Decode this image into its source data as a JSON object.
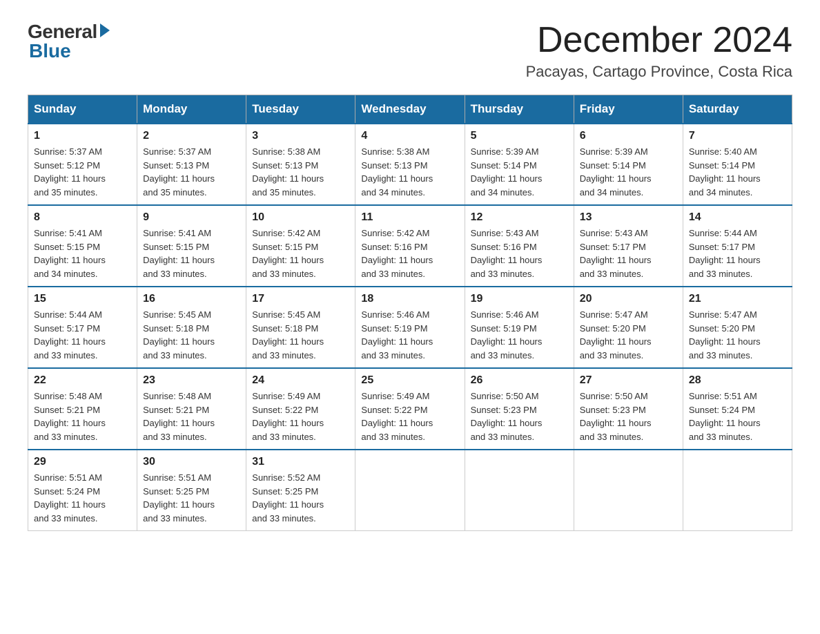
{
  "header": {
    "logo_general": "General",
    "logo_blue": "Blue",
    "main_title": "December 2024",
    "subtitle": "Pacayas, Cartago Province, Costa Rica"
  },
  "days_of_week": [
    "Sunday",
    "Monday",
    "Tuesday",
    "Wednesday",
    "Thursday",
    "Friday",
    "Saturday"
  ],
  "weeks": [
    [
      {
        "day": "1",
        "sunrise": "5:37 AM",
        "sunset": "5:12 PM",
        "daylight": "11 hours and 35 minutes."
      },
      {
        "day": "2",
        "sunrise": "5:37 AM",
        "sunset": "5:13 PM",
        "daylight": "11 hours and 35 minutes."
      },
      {
        "day": "3",
        "sunrise": "5:38 AM",
        "sunset": "5:13 PM",
        "daylight": "11 hours and 35 minutes."
      },
      {
        "day": "4",
        "sunrise": "5:38 AM",
        "sunset": "5:13 PM",
        "daylight": "11 hours and 34 minutes."
      },
      {
        "day": "5",
        "sunrise": "5:39 AM",
        "sunset": "5:14 PM",
        "daylight": "11 hours and 34 minutes."
      },
      {
        "day": "6",
        "sunrise": "5:39 AM",
        "sunset": "5:14 PM",
        "daylight": "11 hours and 34 minutes."
      },
      {
        "day": "7",
        "sunrise": "5:40 AM",
        "sunset": "5:14 PM",
        "daylight": "11 hours and 34 minutes."
      }
    ],
    [
      {
        "day": "8",
        "sunrise": "5:41 AM",
        "sunset": "5:15 PM",
        "daylight": "11 hours and 34 minutes."
      },
      {
        "day": "9",
        "sunrise": "5:41 AM",
        "sunset": "5:15 PM",
        "daylight": "11 hours and 33 minutes."
      },
      {
        "day": "10",
        "sunrise": "5:42 AM",
        "sunset": "5:15 PM",
        "daylight": "11 hours and 33 minutes."
      },
      {
        "day": "11",
        "sunrise": "5:42 AM",
        "sunset": "5:16 PM",
        "daylight": "11 hours and 33 minutes."
      },
      {
        "day": "12",
        "sunrise": "5:43 AM",
        "sunset": "5:16 PM",
        "daylight": "11 hours and 33 minutes."
      },
      {
        "day": "13",
        "sunrise": "5:43 AM",
        "sunset": "5:17 PM",
        "daylight": "11 hours and 33 minutes."
      },
      {
        "day": "14",
        "sunrise": "5:44 AM",
        "sunset": "5:17 PM",
        "daylight": "11 hours and 33 minutes."
      }
    ],
    [
      {
        "day": "15",
        "sunrise": "5:44 AM",
        "sunset": "5:17 PM",
        "daylight": "11 hours and 33 minutes."
      },
      {
        "day": "16",
        "sunrise": "5:45 AM",
        "sunset": "5:18 PM",
        "daylight": "11 hours and 33 minutes."
      },
      {
        "day": "17",
        "sunrise": "5:45 AM",
        "sunset": "5:18 PM",
        "daylight": "11 hours and 33 minutes."
      },
      {
        "day": "18",
        "sunrise": "5:46 AM",
        "sunset": "5:19 PM",
        "daylight": "11 hours and 33 minutes."
      },
      {
        "day": "19",
        "sunrise": "5:46 AM",
        "sunset": "5:19 PM",
        "daylight": "11 hours and 33 minutes."
      },
      {
        "day": "20",
        "sunrise": "5:47 AM",
        "sunset": "5:20 PM",
        "daylight": "11 hours and 33 minutes."
      },
      {
        "day": "21",
        "sunrise": "5:47 AM",
        "sunset": "5:20 PM",
        "daylight": "11 hours and 33 minutes."
      }
    ],
    [
      {
        "day": "22",
        "sunrise": "5:48 AM",
        "sunset": "5:21 PM",
        "daylight": "11 hours and 33 minutes."
      },
      {
        "day": "23",
        "sunrise": "5:48 AM",
        "sunset": "5:21 PM",
        "daylight": "11 hours and 33 minutes."
      },
      {
        "day": "24",
        "sunrise": "5:49 AM",
        "sunset": "5:22 PM",
        "daylight": "11 hours and 33 minutes."
      },
      {
        "day": "25",
        "sunrise": "5:49 AM",
        "sunset": "5:22 PM",
        "daylight": "11 hours and 33 minutes."
      },
      {
        "day": "26",
        "sunrise": "5:50 AM",
        "sunset": "5:23 PM",
        "daylight": "11 hours and 33 minutes."
      },
      {
        "day": "27",
        "sunrise": "5:50 AM",
        "sunset": "5:23 PM",
        "daylight": "11 hours and 33 minutes."
      },
      {
        "day": "28",
        "sunrise": "5:51 AM",
        "sunset": "5:24 PM",
        "daylight": "11 hours and 33 minutes."
      }
    ],
    [
      {
        "day": "29",
        "sunrise": "5:51 AM",
        "sunset": "5:24 PM",
        "daylight": "11 hours and 33 minutes."
      },
      {
        "day": "30",
        "sunrise": "5:51 AM",
        "sunset": "5:25 PM",
        "daylight": "11 hours and 33 minutes."
      },
      {
        "day": "31",
        "sunrise": "5:52 AM",
        "sunset": "5:25 PM",
        "daylight": "11 hours and 33 minutes."
      },
      null,
      null,
      null,
      null
    ]
  ],
  "labels": {
    "sunrise_prefix": "Sunrise: ",
    "sunset_prefix": "Sunset: ",
    "daylight_prefix": "Daylight: "
  }
}
